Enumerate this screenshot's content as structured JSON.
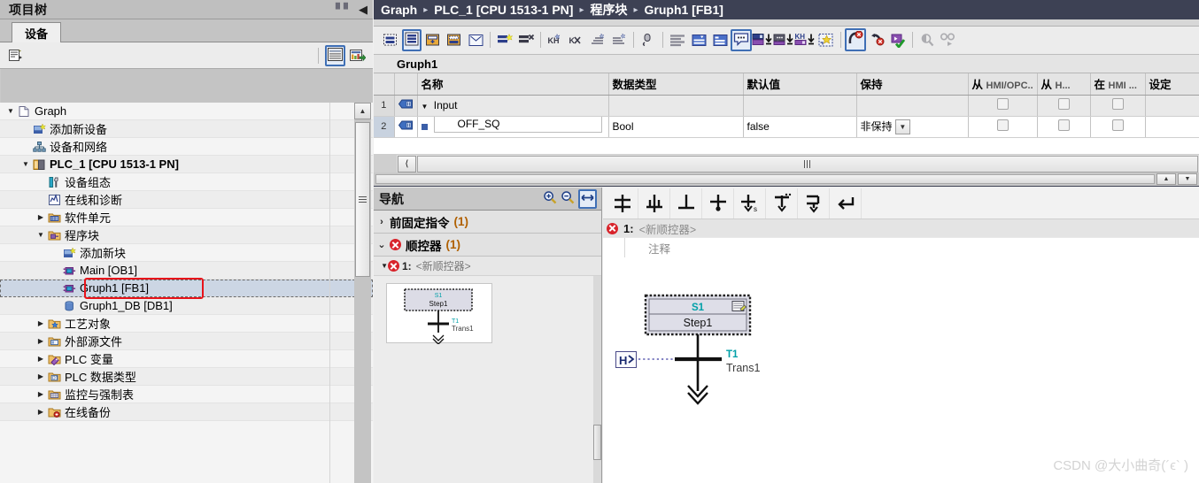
{
  "project_tree": {
    "title": "项目树",
    "title_buttons": [
      "columns-icon",
      "collapse-left-icon"
    ],
    "tab_label": "设备",
    "toolbar": {
      "left_icon": "tree-filter-icon",
      "right_icons": [
        "show-table-icon",
        "export-table-icon"
      ]
    },
    "items": [
      {
        "label": "Graph",
        "indent": 0,
        "twisty": "down",
        "icon": "project-icon",
        "bold": false,
        "selected": false
      },
      {
        "label": "添加新设备",
        "indent": 1,
        "twisty": "",
        "icon": "add-device-icon",
        "bold": false,
        "selected": false
      },
      {
        "label": "设备和网络",
        "indent": 1,
        "twisty": "",
        "icon": "devices-networks-icon",
        "bold": false,
        "selected": false
      },
      {
        "label": "PLC_1 [CPU 1513-1 PN]",
        "indent": 1,
        "twisty": "down",
        "icon": "plc-icon",
        "bold": true,
        "selected": false
      },
      {
        "label": "设备组态",
        "indent": 2,
        "twisty": "",
        "icon": "device-config-icon",
        "bold": false,
        "selected": false
      },
      {
        "label": "在线和诊断",
        "indent": 2,
        "twisty": "",
        "icon": "online-diagnostics-icon",
        "bold": false,
        "selected": false
      },
      {
        "label": "软件单元",
        "indent": 2,
        "twisty": "right",
        "icon": "software-units-folder-icon",
        "bold": false,
        "selected": false
      },
      {
        "label": "程序块",
        "indent": 2,
        "twisty": "down",
        "icon": "program-blocks-folder-icon",
        "bold": false,
        "selected": false
      },
      {
        "label": "添加新块",
        "indent": 3,
        "twisty": "",
        "icon": "add-block-icon",
        "bold": false,
        "selected": false
      },
      {
        "label": "Main [OB1]",
        "indent": 3,
        "twisty": "",
        "icon": "ob-block-icon",
        "bold": false,
        "selected": false
      },
      {
        "label": "Gruph1 [FB1]",
        "indent": 3,
        "twisty": "",
        "icon": "fb-block-icon",
        "bold": false,
        "selected": true
      },
      {
        "label": "Gruph1_DB [DB1]",
        "indent": 3,
        "twisty": "",
        "icon": "db-block-icon",
        "bold": false,
        "selected": false
      },
      {
        "label": "工艺对象",
        "indent": 2,
        "twisty": "right",
        "icon": "technology-objects-folder-icon",
        "bold": false,
        "selected": false
      },
      {
        "label": "外部源文件",
        "indent": 2,
        "twisty": "right",
        "icon": "external-sources-folder-icon",
        "bold": false,
        "selected": false
      },
      {
        "label": "PLC 变量",
        "indent": 2,
        "twisty": "right",
        "icon": "plc-tags-folder-icon",
        "bold": false,
        "selected": false
      },
      {
        "label": "PLC 数据类型",
        "indent": 2,
        "twisty": "right",
        "icon": "plc-datatypes-folder-icon",
        "bold": false,
        "selected": false
      },
      {
        "label": "监控与强制表",
        "indent": 2,
        "twisty": "right",
        "icon": "watch-force-tables-folder-icon",
        "bold": false,
        "selected": false
      },
      {
        "label": "在线备份",
        "indent": 2,
        "twisty": "right",
        "icon": "online-backups-folder-icon",
        "bold": false,
        "selected": false
      }
    ]
  },
  "breadcrumb": {
    "crumbs": [
      "Graph",
      "PLC_1 [CPU 1513-1 PN]",
      "程序块",
      "Gruph1 [FB1]"
    ],
    "separator": "▸"
  },
  "editor_toolbar": {
    "icons": [
      "insert-network-icon",
      "network-overview-icon",
      "insert-branch-icon",
      "insert-box-icon",
      "comment-box-icon",
      "add-network-icon",
      "delete-network-icon",
      "goto-branch-icon",
      "cut-branch-icon",
      "sort-asc-icon",
      "sort-desc-icon",
      "undo-pointer-icon",
      "absolute-view-icon",
      "symbolic-view-icon",
      "symbol-info-icon",
      "show-comment-icon",
      "download-block-icon",
      "download-comment-icon",
      "download-tags-icon",
      "favorites-icon",
      "monitor-on-icon",
      "monitor-off-icon",
      "online-block-icon",
      "search-disabled-icon",
      "glasses-disabled-icon"
    ],
    "active_indices": [
      1,
      15,
      20
    ]
  },
  "interface": {
    "title": "Gruph1",
    "columns": [
      "",
      "",
      "名称",
      "数据类型",
      "默认值",
      "保持",
      "从 HMI/OPC..",
      "从 H...",
      "在 HMI ...",
      "设定"
    ],
    "rows": [
      {
        "num": "1",
        "icon": "input-param-icon",
        "twisty": "down",
        "marker": "",
        "name": "Input",
        "datatype": "",
        "default": "",
        "retain": "",
        "retain_dropdown": false,
        "hmi_opc": false,
        "hmi": false,
        "in_hmi": false,
        "setpoint": false,
        "selected_name": false
      },
      {
        "num": "2",
        "icon": "input-param-icon",
        "twisty": "",
        "marker": "square",
        "name": "OFF_SQ",
        "datatype": "Bool",
        "default": "false",
        "retain": "非保持",
        "retain_dropdown": true,
        "hmi_opc": false,
        "hmi": false,
        "in_hmi": false,
        "setpoint": false,
        "selected_name": true
      }
    ]
  },
  "navigation": {
    "title": "导航",
    "tools": [
      "zoom-in-icon",
      "zoom-out-icon",
      "fit-width-icon"
    ],
    "sections": [
      {
        "twisty": "right",
        "label": "前固定指令",
        "count": "(1)",
        "error": false
      },
      {
        "twisty": "down",
        "label": "顺控器",
        "count": "(1)",
        "error": true
      }
    ],
    "sub_item": {
      "twisty": "down",
      "error": true,
      "num": "1:",
      "label": "<新顺控器>"
    },
    "thumbnail": {
      "step_id": "S1",
      "step_name": "Step1",
      "trans_id": "T1",
      "trans_name": "Trans1"
    }
  },
  "graph": {
    "toolbar_icons": [
      "insert-step-transition-icon",
      "insert-step-icon",
      "insert-transition-icon",
      "insert-jump-icon",
      "insert-simultaneous-branch-icon",
      "insert-alternative-branch-icon",
      "insert-sequence-end-icon",
      "insert-return-icon"
    ],
    "sequence": {
      "num": "1:",
      "name": "<新顺控器>",
      "comment": "注释",
      "error": true
    },
    "step": {
      "id": "S1",
      "name": "Step1",
      "actions_icon": "step-actions-icon",
      "transition": {
        "id": "T1",
        "name": "Trans1",
        "condition_icon": "transition-condition-icon"
      },
      "end_arrow": "double-down-arrow"
    }
  },
  "watermark": "CSDN @大小曲奇(´ϵ`    )",
  "colors": {
    "breadcrumb_bg": "#3d4154",
    "selection": "#ccd6e4",
    "highlight_box": "#e8131a",
    "error_red": "#d8232a",
    "count_orange": "#b06000",
    "step_id_teal": "#00a0a8",
    "trans_name_olive": "#7a6a2a"
  }
}
